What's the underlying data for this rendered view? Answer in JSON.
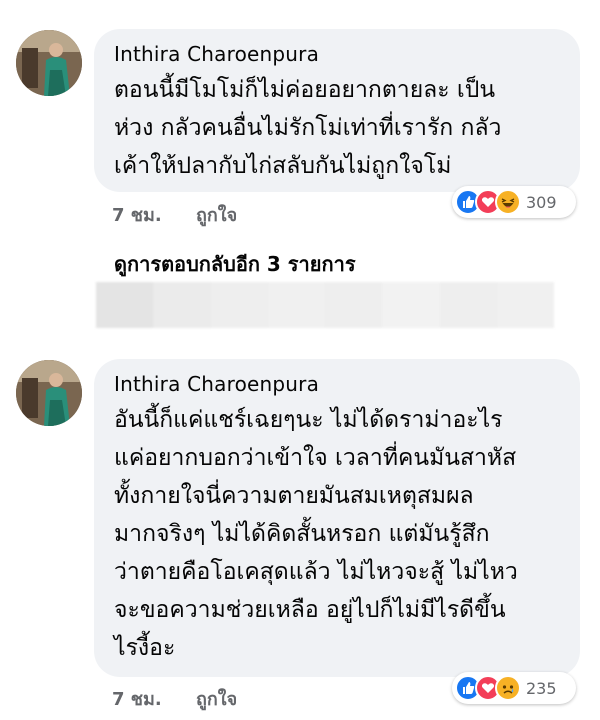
{
  "comments": [
    {
      "author": "Inthira Charoenpura",
      "text": "ตอนนี้มีโมโม่ก็ไม่ค่อยอยากตายละ เป็น\nห่วง กลัวคนอื่นไม่รักโม่เท่าที่เรารัก กลัว\nเค้าให้ปลากับไก่สลับกันไม่ถูกใจโม่",
      "time": "7 ชม.",
      "like_label": "ถูกใจ",
      "reaction_count": "309",
      "reactions": [
        "like-icon",
        "love-icon",
        "haha-icon"
      ]
    },
    {
      "author": "Inthira Charoenpura",
      "text": "อันนี้ก็แค่แชร์เฉยๆนะ ไม่ได้ดราม่าอะไร\nแค่อยากบอกว่าเข้าใจ เวลาที่คนมันสาหัส\nทั้งกายใจนี่ความตายมันสมเหตุสมผล\nมากจริงๆ ไม่ได้คิดสั้นหรอก แต่มันรู้สึก\nว่าตายคือโอเคสุดแล้ว ไม่ไหวจะสู้ ไม่ไหว\nจะขอความช่วยเหลือ อยู่ไปก็ไม่มีไรดีขึ้น\nไรงี้อะ",
      "time": "7 ชม.",
      "like_label": "ถูกใจ",
      "reaction_count": "235",
      "reactions": [
        "like-icon",
        "love-icon",
        "sad-icon"
      ]
    }
  ],
  "view_more_replies": "ดูการตอบกลับอีก 3 รายการ",
  "colors": {
    "like": "#1877f2",
    "love": "#f33e58",
    "haha": "#f7b125",
    "bubble": "#f0f2f5",
    "meta": "#65676b"
  }
}
